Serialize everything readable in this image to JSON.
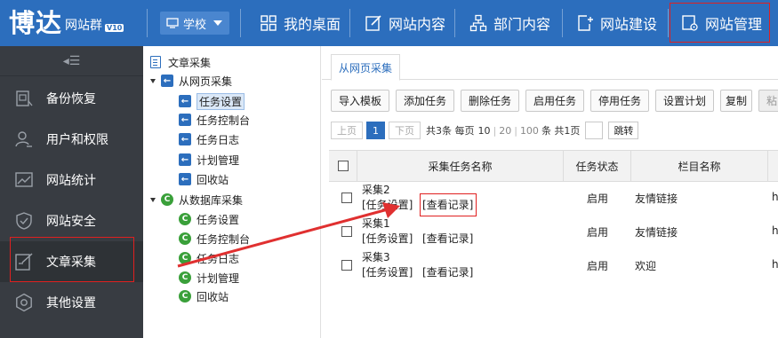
{
  "app": {
    "logo": "博达",
    "logo_sub": "网站群",
    "version": "V10"
  },
  "topbar": {
    "school_select": "学校",
    "nav": [
      {
        "label": "我的桌面",
        "icon": "grid-icon"
      },
      {
        "label": "网站内容",
        "icon": "edit-icon"
      },
      {
        "label": "部门内容",
        "icon": "org-chart-icon"
      },
      {
        "label": "网站建设",
        "icon": "add-page-icon"
      },
      {
        "label": "网站管理",
        "icon": "site-settings-icon"
      }
    ]
  },
  "sidebar": {
    "toggle": "◂☰",
    "items": [
      {
        "label": "备份恢复",
        "icon": "backup-icon"
      },
      {
        "label": "用户和权限",
        "icon": "user-key-icon"
      },
      {
        "label": "网站统计",
        "icon": "stats-chart-icon"
      },
      {
        "label": "网站安全",
        "icon": "shield-icon"
      },
      {
        "label": "文章采集",
        "icon": "article-edit-icon"
      },
      {
        "label": "其他设置",
        "icon": "gear-icon"
      }
    ]
  },
  "tree": {
    "root": "文章采集",
    "web_group": "从网页采集",
    "web_items": [
      "任务设置",
      "任务控制台",
      "任务日志",
      "计划管理",
      "回收站"
    ],
    "db_group": "从数据库采集",
    "db_items": [
      "任务设置",
      "任务控制台",
      "任务日志",
      "计划管理",
      "回收站"
    ]
  },
  "content": {
    "tab": "从网页采集",
    "toolbar": [
      "导入模板",
      "添加任务",
      "删除任务",
      "启用任务",
      "停用任务",
      "设置计划",
      "复制",
      "粘"
    ],
    "pager": {
      "prev": "上页",
      "current": "1",
      "next": "下页",
      "total_text": "共3条 每页",
      "size_10": "10",
      "sep1": "|",
      "size_20": "20",
      "sep2": "|",
      "size_100": "100",
      "pages_text": "条 共1页",
      "go": "跳转"
    },
    "columns": [
      "采集任务名称",
      "任务状态",
      "栏目名称"
    ],
    "rows": [
      {
        "name": "采集2",
        "links": "[任务设置]",
        "record": "[查看记录]",
        "status": "启用",
        "column": "友情链接",
        "extra": "h"
      },
      {
        "name": "采集1",
        "links": "[任务设置]",
        "record": "[查看记录]",
        "status": "启用",
        "column": "友情链接",
        "extra": "h"
      },
      {
        "name": "采集3",
        "links": "[任务设置]",
        "record": "[查看记录]",
        "status": "启用",
        "column": "欢迎",
        "extra": "h"
      }
    ]
  },
  "colors": {
    "brand": "#2c6ebd",
    "sidebar_bg": "#383c42",
    "highlight": "#e02020"
  }
}
